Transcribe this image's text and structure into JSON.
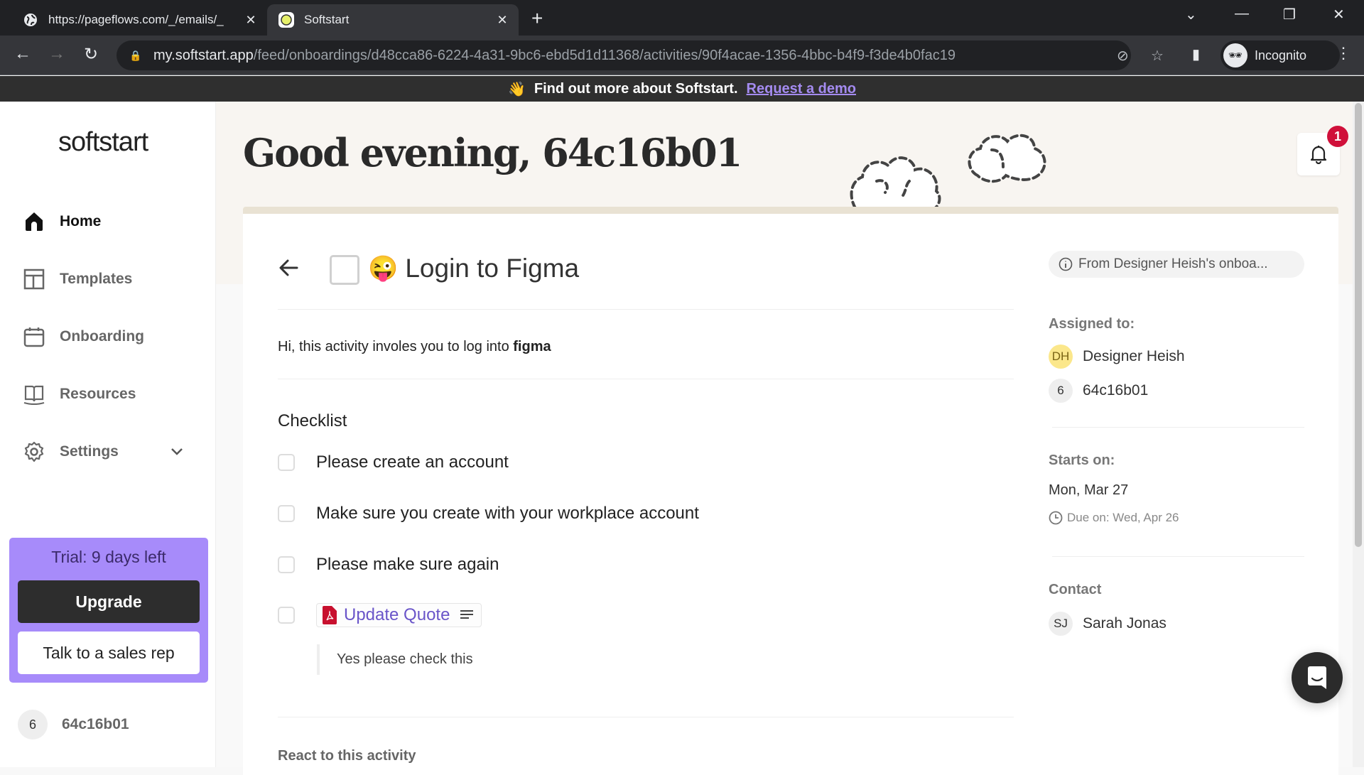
{
  "browser": {
    "tabs": [
      {
        "title": "https://pageflows.com/_/emails/_",
        "icon": "globe-icon",
        "active": false
      },
      {
        "title": "Softstart",
        "icon": "softstart-favicon",
        "active": true
      }
    ],
    "url_host": "my.softstart.app",
    "url_path": "/feed/onboardings/d48cca86-6224-4a31-9bc6-ebd5d1d11368/activities/90f4acae-1356-4bbc-b4f9-f3de4b0fac19",
    "profile_label": "Incognito"
  },
  "banner": {
    "emoji": "👋",
    "text": "Find out more about Softstart.",
    "link": "Request a demo"
  },
  "sidebar": {
    "logo": "softstart",
    "items": [
      {
        "label": "Home",
        "icon": "home-icon",
        "active": true
      },
      {
        "label": "Templates",
        "icon": "templates-icon",
        "active": false
      },
      {
        "label": "Onboarding",
        "icon": "calendar-icon",
        "active": false
      },
      {
        "label": "Resources",
        "icon": "book-icon",
        "active": false
      },
      {
        "label": "Settings",
        "icon": "gear-icon",
        "active": false,
        "expandable": true
      }
    ],
    "trial": {
      "text": "Trial: 9 days left",
      "upgrade": "Upgrade",
      "sales": "Talk to a sales rep"
    },
    "user": {
      "initial": "6",
      "name": "64c16b01"
    }
  },
  "header": {
    "greeting": "Good evening, 64c16b01",
    "notification_count": "1"
  },
  "activity": {
    "emoji": "😜",
    "title": "Login to Figma",
    "source": "From Designer Heish's onboa...",
    "description_prefix": "Hi, this activity involes you to log into ",
    "description_bold": "figma",
    "checklist_heading": "Checklist",
    "checklist": [
      {
        "label": "Please create an account",
        "checked": false
      },
      {
        "label": "Make sure you create with your workplace account",
        "checked": false
      },
      {
        "label": "Please make sure again",
        "checked": false
      }
    ],
    "file_item": {
      "label": "Update Quote",
      "checked": false,
      "note": "Yes please check this"
    },
    "react_label": "React to this activity"
  },
  "details": {
    "assigned_label": "Assigned to:",
    "assignees": [
      {
        "initials": "DH",
        "name": "Designer Heish"
      },
      {
        "initials": "6",
        "name": "64c16b01"
      }
    ],
    "starts_label": "Starts on:",
    "starts_value": "Mon, Mar 27",
    "due_value": "Due on: Wed, Apr 26",
    "contact_label": "Contact",
    "contact": {
      "initials": "SJ",
      "name": "Sarah Jonas"
    }
  },
  "colors": {
    "accent": "#a78bfa",
    "link": "#6a55c9",
    "badge": "#d0103a",
    "hero_bg": "#f8f5f1"
  }
}
